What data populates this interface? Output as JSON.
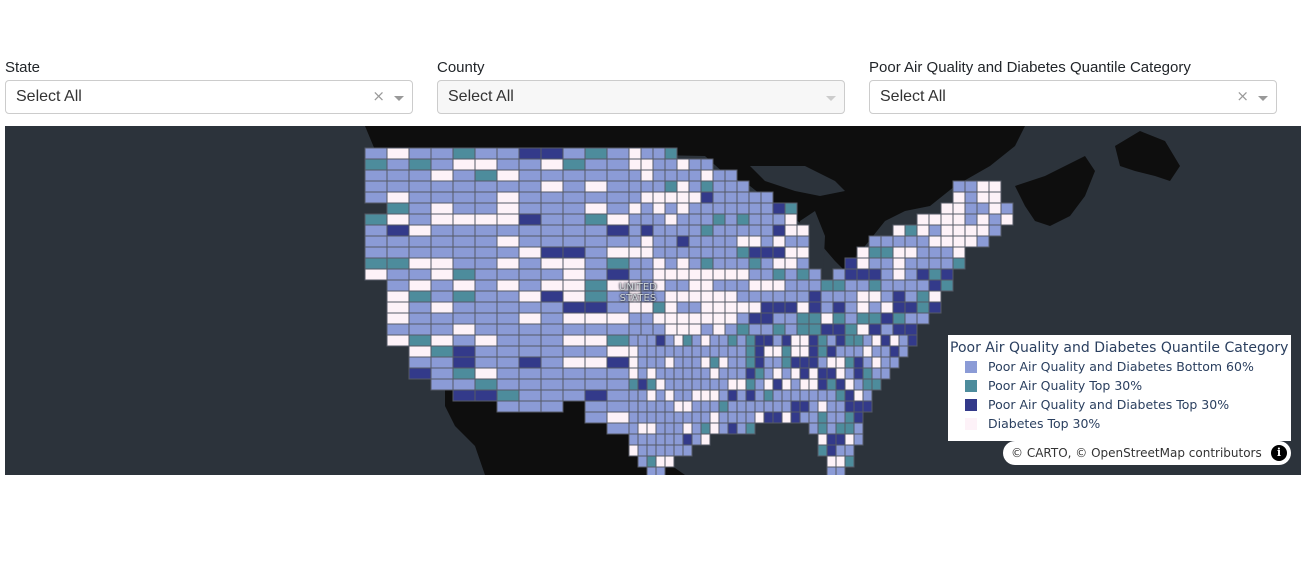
{
  "filters": {
    "state": {
      "label": "State",
      "value": "Select All",
      "clearable": true,
      "disabled": false
    },
    "county": {
      "label": "County",
      "value": "Select All",
      "clearable": false,
      "disabled": true
    },
    "category": {
      "label": "Poor Air Quality and Diabetes Quantile Category",
      "value": "Select All",
      "clearable": true,
      "disabled": false
    },
    "clear_glyph": "×"
  },
  "map": {
    "basemap": "CARTO dark",
    "country_label_line1": "UNITED",
    "country_label_line2": "STATES",
    "colors": {
      "water": "#2c333b",
      "land": "#0e0e0e",
      "county_border": "#555a66"
    },
    "legend": {
      "title": "Poor Air Quality and Diabetes Quantile Category",
      "items": [
        {
          "label": "Poor Air Quality and Diabetes Bottom 60%",
          "color": "#8b9bd6"
        },
        {
          "label": "Poor Air Quality Top 30%",
          "color": "#4d8c9c"
        },
        {
          "label": "Poor Air Quality and Diabetes Top 30%",
          "color": "#333a8a"
        },
        {
          "label": "Diabetes Top 30%",
          "color": "#fdf2f8"
        }
      ]
    },
    "attribution": {
      "carto": "© CARTO",
      "separator": ", ",
      "osm": "© OpenStreetMap",
      "contributors": " contributors",
      "info_glyph": "i"
    }
  }
}
